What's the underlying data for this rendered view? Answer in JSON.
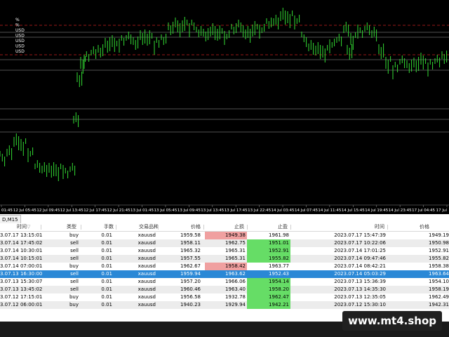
{
  "chart": {
    "symbol_tab": "D,M15",
    "labels": [
      "%",
      "%",
      "USD",
      "USD",
      "USD",
      "USD",
      "USD"
    ],
    "time_labels": [
      "01:45",
      "12 Jul 05:45",
      "12 Jul 09:45",
      "12 Jul 13:45",
      "12 Jul 17:45",
      "12 Jul 21:45",
      "13 Jul 01:45",
      "13 Jul 05:45",
      "13 Jul 09:45",
      "13 Jul 13:45",
      "13 Jul 17:45",
      "13 Jul 22:45",
      "14 Jul 03:45",
      "14 Jul 07:45",
      "14 Jul 11:45",
      "14 Jul 15:45",
      "14 Jul 19:45",
      "14 Jul 23:45",
      "17 Jul 04:45",
      "17 Jul"
    ],
    "colors": {
      "background": "#000000",
      "candle": "#33dd33",
      "grid": "#6b6b6b",
      "sl_line": "#cc2222"
    }
  },
  "table": {
    "headers": {
      "time": "时间",
      "type": "类型",
      "lots": "手数",
      "symbol": "交易品种",
      "price": "价格",
      "sl": "止损",
      "tp": "止盈",
      "close_time": "时间",
      "close_price": "价格"
    },
    "rows": [
      {
        "time": "3.07.17 13:15:01",
        "type": "buy",
        "lots": "0.01",
        "symbol": "xauusd",
        "price": "1959.58",
        "sl": "1949.38",
        "tp": "1961.98",
        "close_time": "2023.07.17 15:47:39",
        "close_price": "1949.19",
        "hit": "sl",
        "selected": false
      },
      {
        "time": "3.07.14 17:45:02",
        "type": "sell",
        "lots": "0.01",
        "symbol": "xauusd",
        "price": "1958.11",
        "sl": "1962.75",
        "tp": "1951.01",
        "close_time": "2023.07.17 10:22:06",
        "close_price": "1950.98",
        "hit": "tp",
        "selected": false
      },
      {
        "time": "3.07.14 10:30:01",
        "type": "sell",
        "lots": "0.01",
        "symbol": "xauusd",
        "price": "1965.32",
        "sl": "1965.31",
        "tp": "1952.91",
        "close_time": "2023.07.14 17:01:25",
        "close_price": "1952.91",
        "hit": "tp",
        "selected": false
      },
      {
        "time": "3.07.14 10:15:01",
        "type": "sell",
        "lots": "0.01",
        "symbol": "xauusd",
        "price": "1957.55",
        "sl": "1965.31",
        "tp": "1955.82",
        "close_time": "2023.07.14 09:47:46",
        "close_price": "1955.82",
        "hit": "tp",
        "selected": false
      },
      {
        "time": "3.07.14 07:00:01",
        "type": "buy",
        "lots": "0.01",
        "symbol": "xauusd",
        "price": "1962.67",
        "sl": "1958.42",
        "tp": "1963.77",
        "close_time": "2023.07.14 08:42:21",
        "close_price": "1958.38",
        "hit": "sl",
        "selected": false
      },
      {
        "time": "3.07.13 16:30:00",
        "type": "sell",
        "lots": "0.01",
        "symbol": "xauusd",
        "price": "1959.94",
        "sl": "1963.62",
        "tp": "1952.43",
        "close_time": "2023.07.14 05:03:29",
        "close_price": "1963.64",
        "hit": "sl",
        "selected": true
      },
      {
        "time": "3.07.13 15:30:07",
        "type": "sell",
        "lots": "0.01",
        "symbol": "xauusd",
        "price": "1957.20",
        "sl": "1966.06",
        "tp": "1954.14",
        "close_time": "2023.07.13 15:36:39",
        "close_price": "1954.10",
        "hit": "tp",
        "selected": false
      },
      {
        "time": "3.07.13 13:45:02",
        "type": "sell",
        "lots": "0.01",
        "symbol": "xauusd",
        "price": "1960.46",
        "sl": "1963.40",
        "tp": "1958.20",
        "close_time": "2023.07.13 14:35:30",
        "close_price": "1958.19",
        "hit": "tp",
        "selected": false
      },
      {
        "time": "3.07.12 17:15:01",
        "type": "buy",
        "lots": "0.01",
        "symbol": "xauusd",
        "price": "1956.58",
        "sl": "1932.78",
        "tp": "1962.47",
        "close_time": "2023.07.13 12:35:05",
        "close_price": "1962.49",
        "hit": "tp",
        "selected": false
      },
      {
        "time": "3.07.12 06:00:01",
        "type": "buy",
        "lots": "0.01",
        "symbol": "xauusd",
        "price": "1940.23",
        "sl": "1929.94",
        "tp": "1942.21",
        "close_time": "2023.07.12 15:30:10",
        "close_price": "1942.31",
        "hit": "tp",
        "selected": false
      }
    ]
  },
  "watermark": "www.mt4.shop"
}
